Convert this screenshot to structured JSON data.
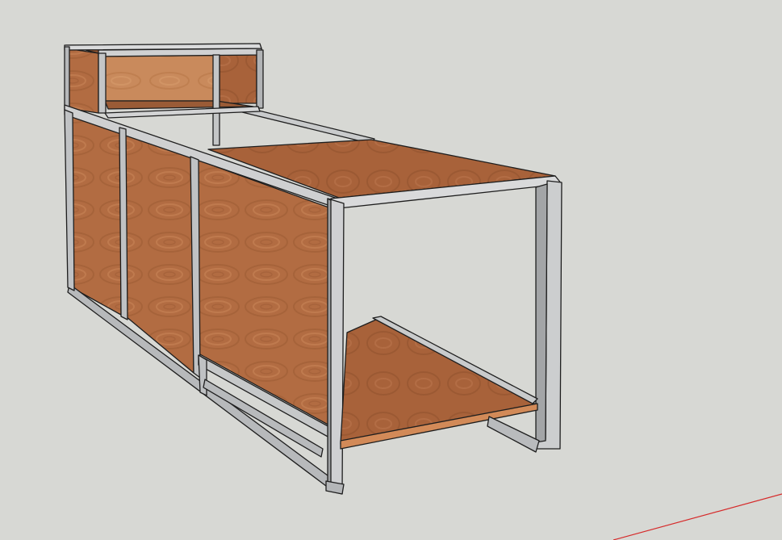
{
  "scene": {
    "subject": "",
    "colors": {
      "background": "#d7d8d4",
      "plywood_light": "#c07a4f",
      "plywood_mid": "#a9653c",
      "plywood_dark": "#8f5230",
      "plywood_top": "#9c5e38",
      "steel_light": "#d9dadb",
      "steel_mid": "#b8babc",
      "steel_dark": "#8e9092",
      "edge": "#1e1e1e",
      "axis_red": "#d62a2a"
    }
  }
}
